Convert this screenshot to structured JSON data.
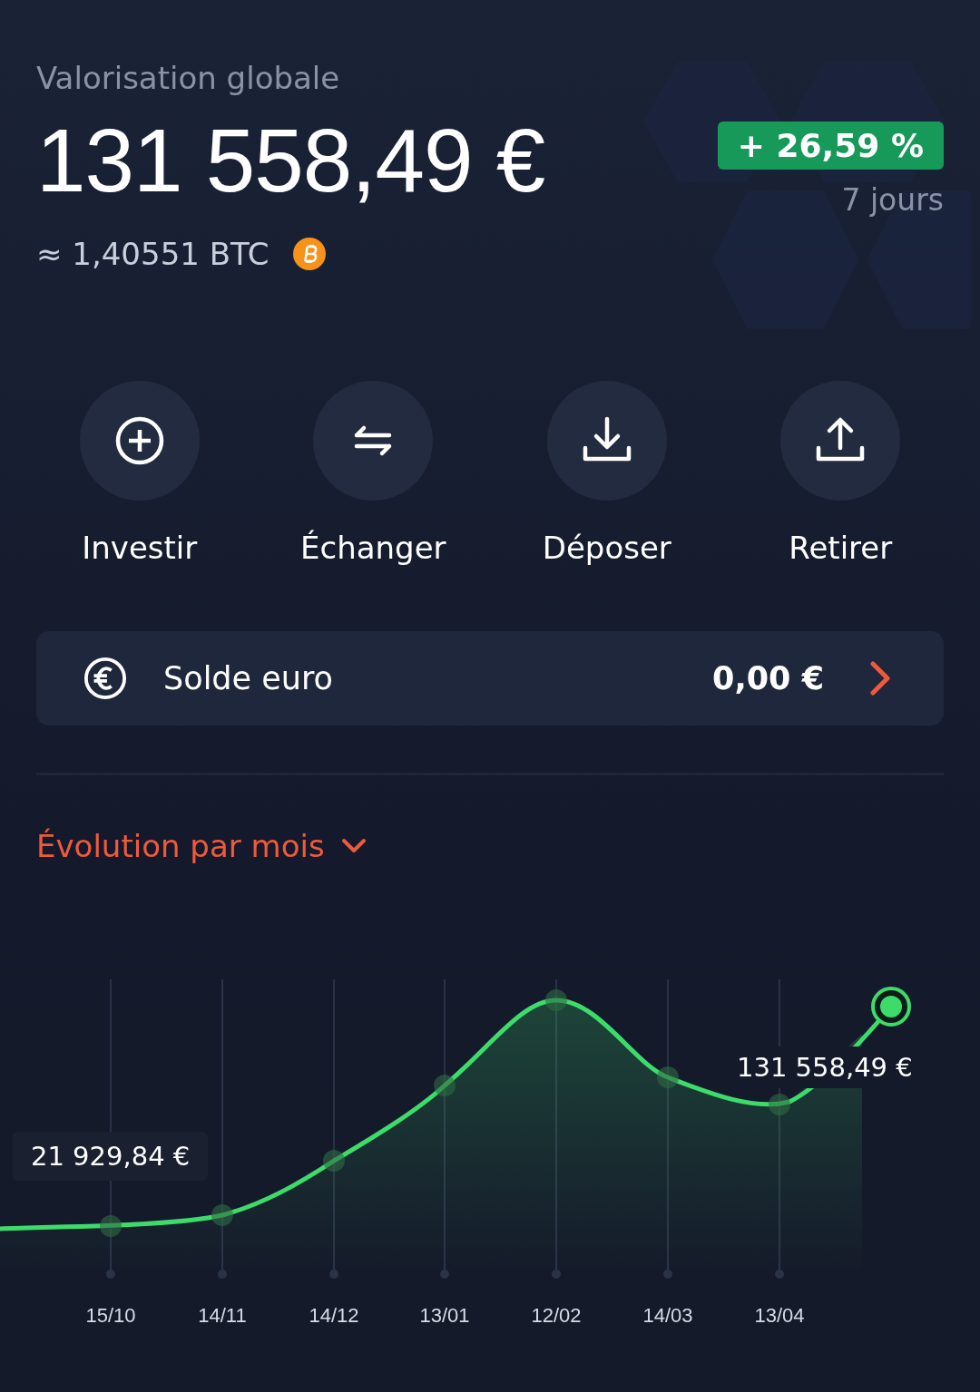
{
  "header": {
    "title": "Valorisation globale",
    "value": "131 558,49 €",
    "btc": "≈ 1,40551 BTC",
    "change": "+ 26,59 %",
    "change_positive": true,
    "period": "7 jours"
  },
  "actions": [
    {
      "label": "Investir",
      "kind": "plus"
    },
    {
      "label": "Échanger",
      "kind": "swap"
    },
    {
      "label": "Déposer",
      "kind": "download"
    },
    {
      "label": "Retirer",
      "kind": "upload"
    }
  ],
  "balance": {
    "label": "Solde euro",
    "value": "0,00 €"
  },
  "chart": {
    "title": "Évolution par mois",
    "start_label": "21 929,84 €",
    "end_label": "131 558,49 €",
    "x_labels": [
      "15/10",
      "14/11",
      "14/12",
      "13/01",
      "12/02",
      "14/03",
      "13/04"
    ]
  }
}
